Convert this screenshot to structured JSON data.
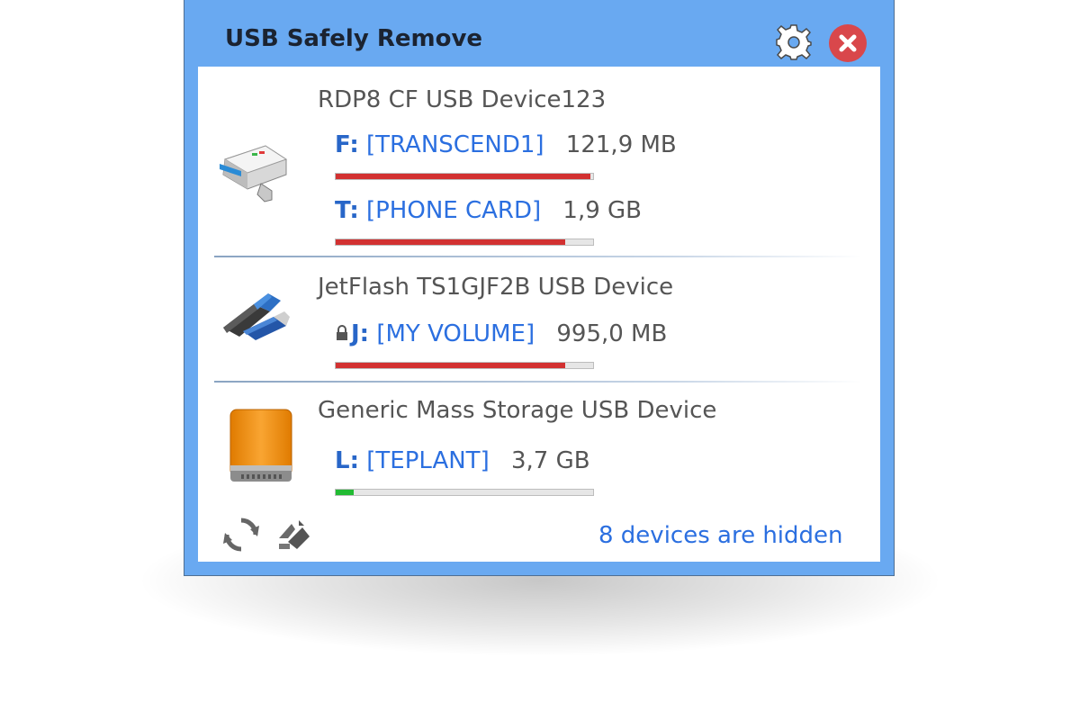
{
  "app": {
    "title": "USB Safely Remove"
  },
  "devices": [
    {
      "name": "RDP8 CF USB Device123",
      "icon": "card-reader-icon",
      "volumes": [
        {
          "letter": "F:",
          "label": "[TRANSCEND1]",
          "size": "121,9 MB",
          "usage": 0.99,
          "bar_color": "#d23131"
        },
        {
          "letter": "T:",
          "label": "[PHONE CARD]",
          "size": "1,9 GB",
          "usage": 0.89,
          "bar_color": "#d23131"
        }
      ]
    },
    {
      "name": "JetFlash TS1GJF2B USB Device",
      "icon": "usb-flash-drive-icon",
      "volumes": [
        {
          "letter": "J:",
          "label": "[MY VOLUME]",
          "size": "995,0 MB",
          "usage": 0.89,
          "bar_color": "#d23131",
          "locked": true
        }
      ]
    },
    {
      "name": "Generic Mass Storage USB Device",
      "icon": "external-hard-drive-icon",
      "volumes": [
        {
          "letter": "L:",
          "label": "[TEPLANT]",
          "size": "3,7 GB",
          "usage": 0.07,
          "bar_color": "#22bb33"
        }
      ]
    }
  ],
  "footer": {
    "hidden_text": "8 devices are hidden",
    "refresh_icon": "refresh-icon",
    "eject_icon": "eject-all-icon"
  },
  "colors": {
    "window_frame": "#69a9f1",
    "link_blue": "#2b6fe0",
    "close_red": "#d9474b",
    "usage_red": "#d23131",
    "usage_green": "#22bb33"
  }
}
